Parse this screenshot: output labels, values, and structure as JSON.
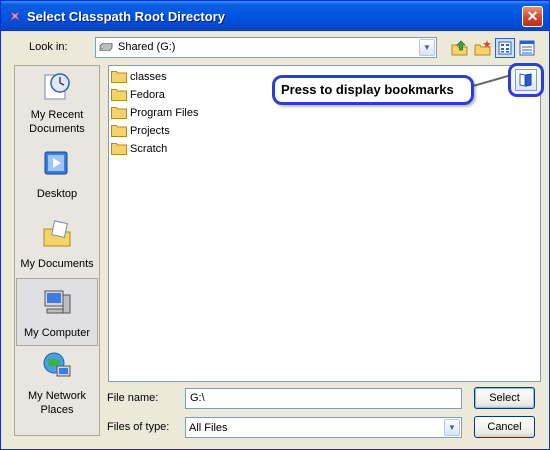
{
  "window": {
    "title": "Select Classpath Root Directory",
    "close_glyph": "✕"
  },
  "toolbar": {
    "look_in_label": "Look in:",
    "look_in_value": "Shared (G:)",
    "icons": [
      "up-folder-icon",
      "new-folder-icon",
      "list-view-icon",
      "details-view-icon"
    ]
  },
  "places": [
    {
      "label": "My Recent Documents",
      "icon": "recent-documents-icon"
    },
    {
      "label": "Desktop",
      "icon": "desktop-icon"
    },
    {
      "label": "My Documents",
      "icon": "my-documents-icon"
    },
    {
      "label": "My Computer",
      "icon": "my-computer-icon",
      "selected": true
    },
    {
      "label": "My Network Places",
      "icon": "network-places-icon"
    }
  ],
  "files": [
    "classes",
    "Fedora",
    "Program Files",
    "Projects",
    "Scratch"
  ],
  "callout": {
    "text": "Press to display bookmarks"
  },
  "form": {
    "file_name_label": "File name:",
    "file_name_value": "G:\\",
    "files_of_type_label": "Files of type:",
    "files_of_type_value": "All Files",
    "select_button": "Select",
    "cancel_button": "Cancel"
  },
  "colors": {
    "title_bar": "#0054e3",
    "callout_border": "#2b3fd6",
    "window_bg": "#ece9d8"
  }
}
